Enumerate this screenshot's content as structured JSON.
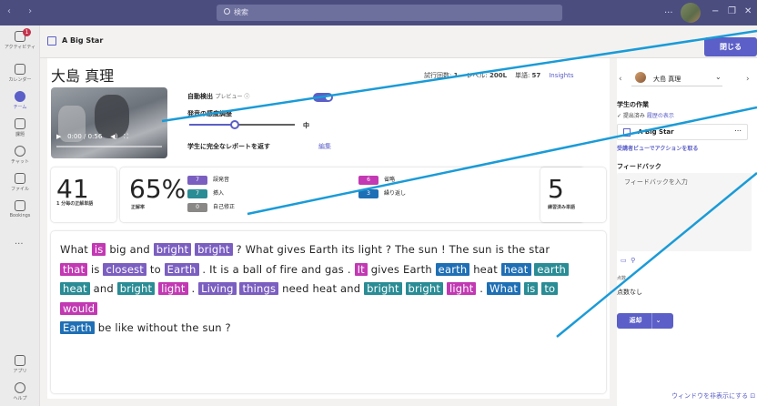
{
  "titlebar": {
    "search_placeholder": "検索",
    "more": "...",
    "min": "−",
    "max": "❐",
    "close": "✕"
  },
  "rail": {
    "activity": "アクティビティ",
    "activity_badge": "1",
    "calendar": "カレンダー",
    "teams": "チーム",
    "assignments": "課題",
    "chat": "チャット",
    "files": "ファイル",
    "bookings": "Bookings",
    "more": "...",
    "apps": "アプリ",
    "help": "ヘルプ"
  },
  "header": {
    "title": "A Big Star",
    "close_button": "閉じる"
  },
  "main": {
    "student_name": "大島 真理",
    "attempts_label": "試行回数:",
    "attempts": "1",
    "level_label": "レベル:",
    "level": "200L",
    "words_label": "単語:",
    "words": "57",
    "insights": "Insights",
    "video_time": "0:00 / 0:56",
    "auto_detect": "自動検出",
    "preview": "プレビュー ⓘ",
    "pronunciation_sensitivity": "発音の感度調整",
    "sensitivity_level": 0.43,
    "sensitivity_value": "中",
    "return_complete_report": "学生に完全なレポートを返す",
    "edit": "編集"
  },
  "stats": {
    "wcpm": "41",
    "wcpm_label": "1 分毎の正解単語",
    "accuracy": "65%",
    "accuracy_label": "正解率",
    "errors": [
      {
        "count": "7",
        "label": "誤発音",
        "color": "#7b5fc0"
      },
      {
        "count": "7",
        "label": "挿入",
        "color": "#2a8c95"
      },
      {
        "count": "0",
        "label": "自己修正",
        "color": "#8a8886"
      },
      {
        "count": "6",
        "label": "省略",
        "color": "#c239b3"
      },
      {
        "count": "3",
        "label": "繰り返し",
        "color": "#1f6fb5"
      }
    ],
    "practiced": "5",
    "practiced_label": "練習済み単語"
  },
  "reading": {
    "lines": [
      [
        [
          "What",
          ""
        ],
        [
          "is",
          "rep"
        ],
        [
          "big",
          ""
        ],
        [
          "and",
          ""
        ],
        [
          "bright",
          "mis"
        ],
        [
          "bright",
          "mis"
        ],
        [
          "? What gives Earth its light ? The sun ! The sun is the star",
          ""
        ]
      ],
      [
        [
          "that",
          "rep"
        ],
        [
          "is",
          ""
        ],
        [
          "closest",
          "mis"
        ],
        [
          "to",
          ""
        ],
        [
          "Earth",
          "mis"
        ],
        [
          ". It is a ball of fire and gas .",
          ""
        ],
        [
          "It",
          "rep"
        ],
        [
          "gives Earth",
          ""
        ],
        [
          "earth",
          "omi"
        ],
        [
          "heat",
          ""
        ],
        [
          "heat",
          "omi"
        ],
        [
          "earth",
          "ins"
        ]
      ],
      [
        [
          "heat",
          "ins"
        ],
        [
          "and",
          ""
        ],
        [
          "bright",
          "ins"
        ],
        [
          "light",
          "rep"
        ],
        [
          ".",
          ""
        ],
        [
          "Living",
          "mis"
        ],
        [
          "things",
          "mis"
        ],
        [
          "need heat and",
          ""
        ],
        [
          "bright",
          "ins"
        ],
        [
          "bright",
          "ins"
        ],
        [
          "light",
          "rep"
        ],
        [
          ".",
          ""
        ],
        [
          "What",
          "omi"
        ],
        [
          "is",
          "ins"
        ],
        [
          "to",
          "ins"
        ],
        [
          "would",
          "rep"
        ]
      ],
      [
        [
          "Earth",
          "omi"
        ],
        [
          "be like without the sun ?",
          ""
        ]
      ]
    ]
  },
  "right": {
    "student_name": "大島 真理",
    "student_work": "学生の作業",
    "submitted": "✓ 提出済み",
    "history": "履歴の表示",
    "file_name": "A Big Star",
    "file_more": "⋯",
    "take_action": "受講者ビューでアクションを取る",
    "feedback": "フィードバック",
    "feedback_placeholder": "フィードバックを入力",
    "points_label": "点数",
    "points": "点数なし",
    "return_button": "返却",
    "hide_window": "ウィンドウを非表示にする"
  },
  "colors": {
    "brand": "#5b5fc7",
    "titlebar": "#4b4d7f",
    "annotation": "#1a9bd7"
  }
}
